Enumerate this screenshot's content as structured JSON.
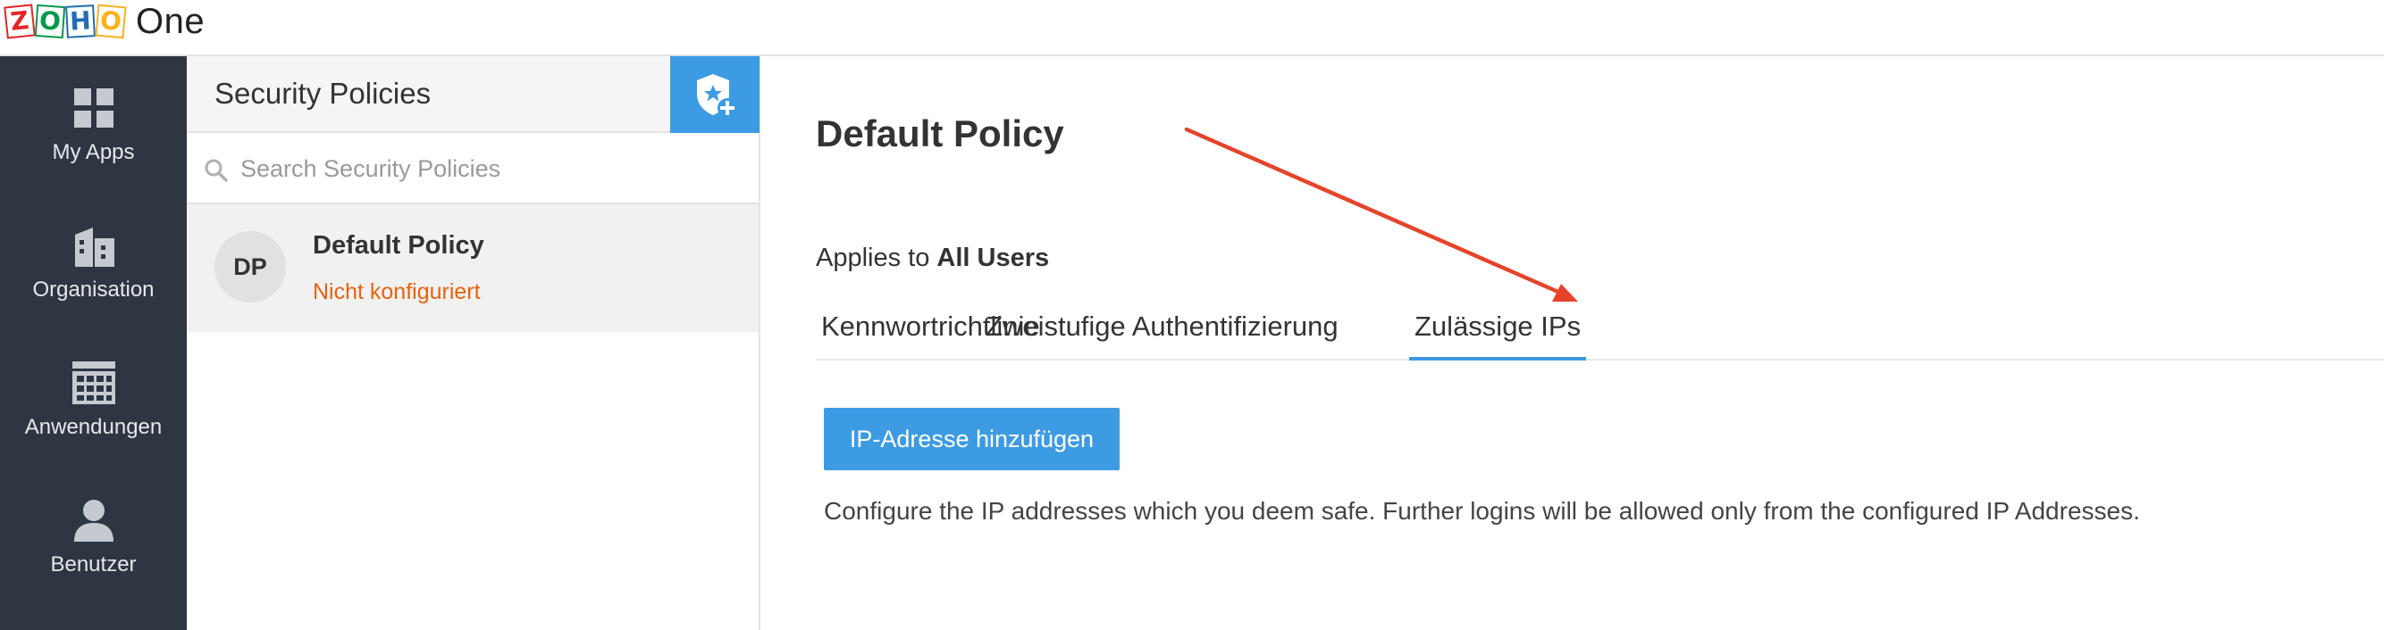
{
  "header": {
    "logo_letters": [
      "Z",
      "O",
      "H",
      "O"
    ],
    "product": "One"
  },
  "nav": {
    "items": [
      {
        "label": "My Apps",
        "icon": "grid-icon"
      },
      {
        "label": "Organisation",
        "icon": "building-icon"
      },
      {
        "label": "Anwendungen",
        "icon": "apps-calendar-icon"
      },
      {
        "label": "Benutzer",
        "icon": "user-icon"
      }
    ]
  },
  "policies_panel": {
    "title": "Security Policies",
    "add_icon": "shield-star-plus-icon",
    "search": {
      "placeholder": "Search Security Policies",
      "value": ""
    },
    "items": [
      {
        "initials": "DP",
        "name": "Default Policy",
        "status": "Nicht konfiguriert"
      }
    ]
  },
  "main": {
    "title": "Default Policy",
    "applies_prefix": "Applies to",
    "applies_value": "All Users",
    "tabs": [
      {
        "label": "Kennwortrichtlinie",
        "active": false
      },
      {
        "label": "Zweistufige Authentifizierung",
        "active": false
      },
      {
        "label": "Zulässige IPs",
        "active": true
      }
    ],
    "add_ip_button": "IP-Adresse hinzufügen",
    "description": "Configure the IP addresses which you deem safe. Further logins will be allowed only from the configured IP Addresses."
  },
  "colors": {
    "accent": "#3d9be3",
    "sidebar": "#2e3642",
    "status_warning": "#e8620d",
    "annotation_arrow": "#e5442b"
  }
}
